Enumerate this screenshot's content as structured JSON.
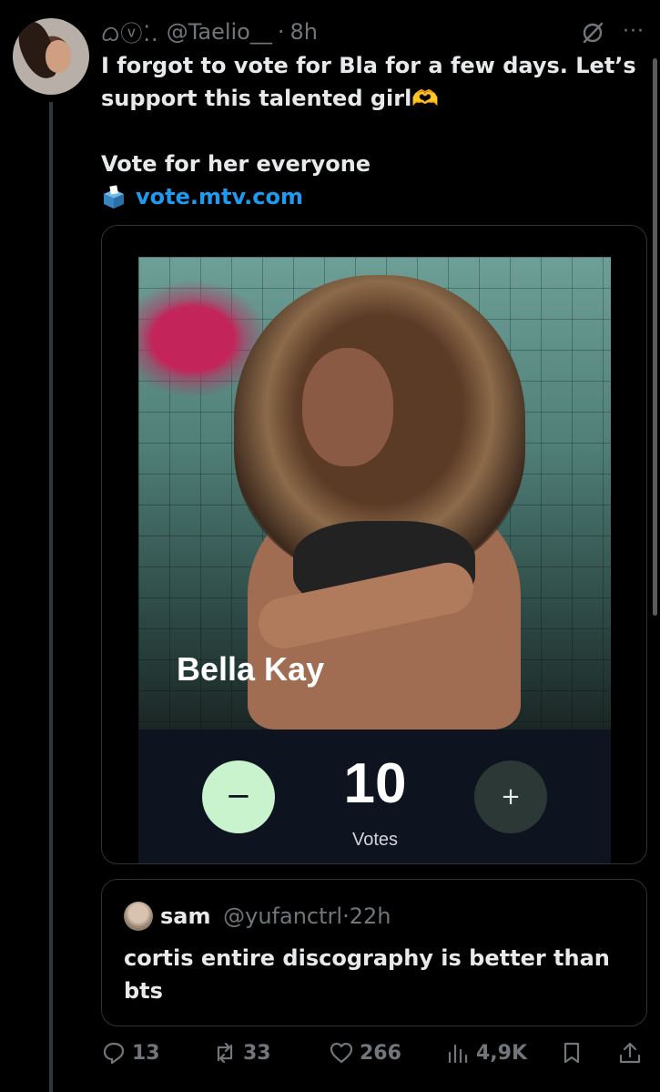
{
  "author": {
    "display_emoji": "ᜊⓥ⁚.",
    "handle": "@Taelio__",
    "time": "8h"
  },
  "tweet": {
    "line1": "I forgot to vote for Bla for a few days. Let’s support this talented girl🫶",
    "line2": "Vote for her everyone",
    "link": "vote.mtv.com"
  },
  "card": {
    "artist_name": "Bella Kay",
    "vote_count": "10",
    "votes_label": "Votes",
    "minus_symbol": "−",
    "plus_symbol": "+"
  },
  "quote": {
    "name": "sam",
    "handle": "@yufanctrl",
    "time": "22h",
    "text": "cortis entire discography is better than bts"
  },
  "actions": {
    "replies": "13",
    "reposts": "33",
    "likes": "266",
    "views": "4,9K"
  },
  "icons": [
    "avatar",
    "grok-icon",
    "more-icon",
    "ballot-box-icon",
    "reply-icon",
    "repost-icon",
    "like-icon",
    "views-icon",
    "bookmark-icon",
    "share-icon"
  ],
  "colors": {
    "link": "#1d9bf0",
    "secondary_text": "#71767b",
    "minus_button": "#c8f3cc",
    "plus_button": "#2c3836",
    "vote_panel": "#0e1320"
  }
}
